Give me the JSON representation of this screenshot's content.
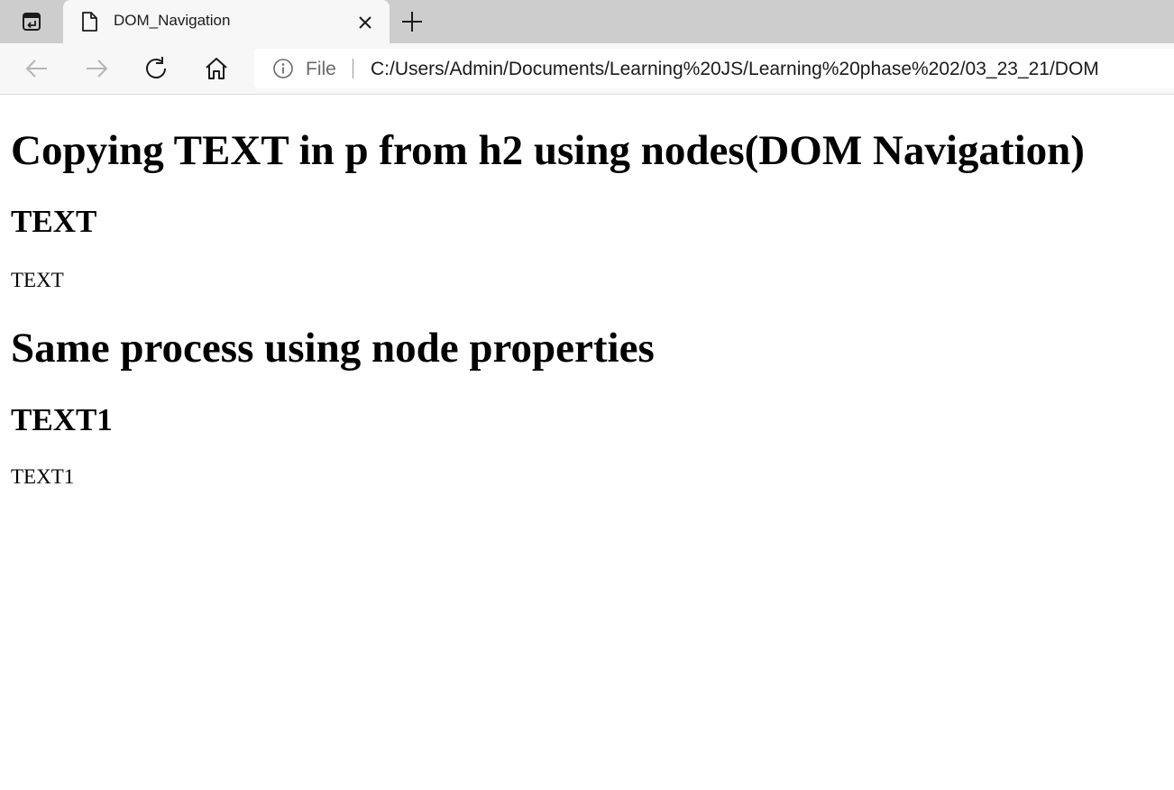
{
  "browser": {
    "tab": {
      "title": "DOM_Navigation"
    },
    "address_bar": {
      "scheme_label": "File",
      "url": "C:/Users/Admin/Documents/Learning%20JS/Learning%20phase%202/03_23_21/DOM"
    }
  },
  "page": {
    "heading1": "Copying TEXT in p from h2 using nodes(DOM Navigation)",
    "h2_first": "TEXT",
    "p_first": "TEXT",
    "heading2": "Same process using node properties",
    "h2_second": "TEXT1",
    "p_second": "TEXT1"
  },
  "colors": {
    "tabbar_bg": "#cdcdcd",
    "toolbar_bg": "#f7f7f7",
    "disabled_icon": "#b5b5b5",
    "icon": "#1b1b1b"
  },
  "icons": [
    "tab-actions-icon",
    "page-icon",
    "close-icon",
    "plus-icon",
    "back-arrow-icon",
    "forward-arrow-icon",
    "refresh-icon",
    "home-icon",
    "info-icon"
  ]
}
